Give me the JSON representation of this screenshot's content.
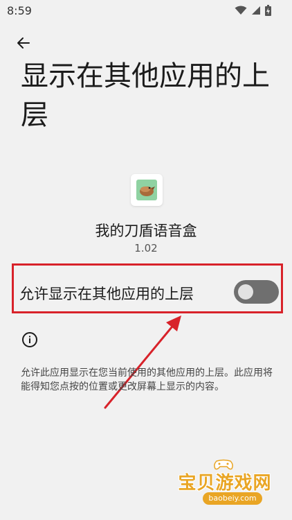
{
  "status_bar": {
    "time": "8:59"
  },
  "page": {
    "title": "显示在其他应用的上层"
  },
  "app": {
    "name": "我的刀盾语音盒",
    "version": "1.02"
  },
  "permission": {
    "label": "允许显示在其他应用的上层",
    "enabled": false
  },
  "description": "允许此应用显示在您当前使用的其他应用的上层。此应用将能得知您点按的位置或更改屏幕上显示的内容。",
  "watermark": {
    "text": "宝贝游戏网",
    "url": "baobeiy.com"
  },
  "colors": {
    "background": "#f1f1f1",
    "annotation_red": "#d8222a",
    "toggle_track_off": "#6f6f6f",
    "toggle_knob_off": "#e2e2e2",
    "app_icon_bg": "#8fd2a2",
    "watermark_gold": "#e9a524"
  },
  "icons": {
    "back": "arrow-back-icon",
    "wifi": "wifi-icon",
    "signal": "cell-signal-icon",
    "battery": "battery-charging-icon",
    "info": "info-icon"
  }
}
